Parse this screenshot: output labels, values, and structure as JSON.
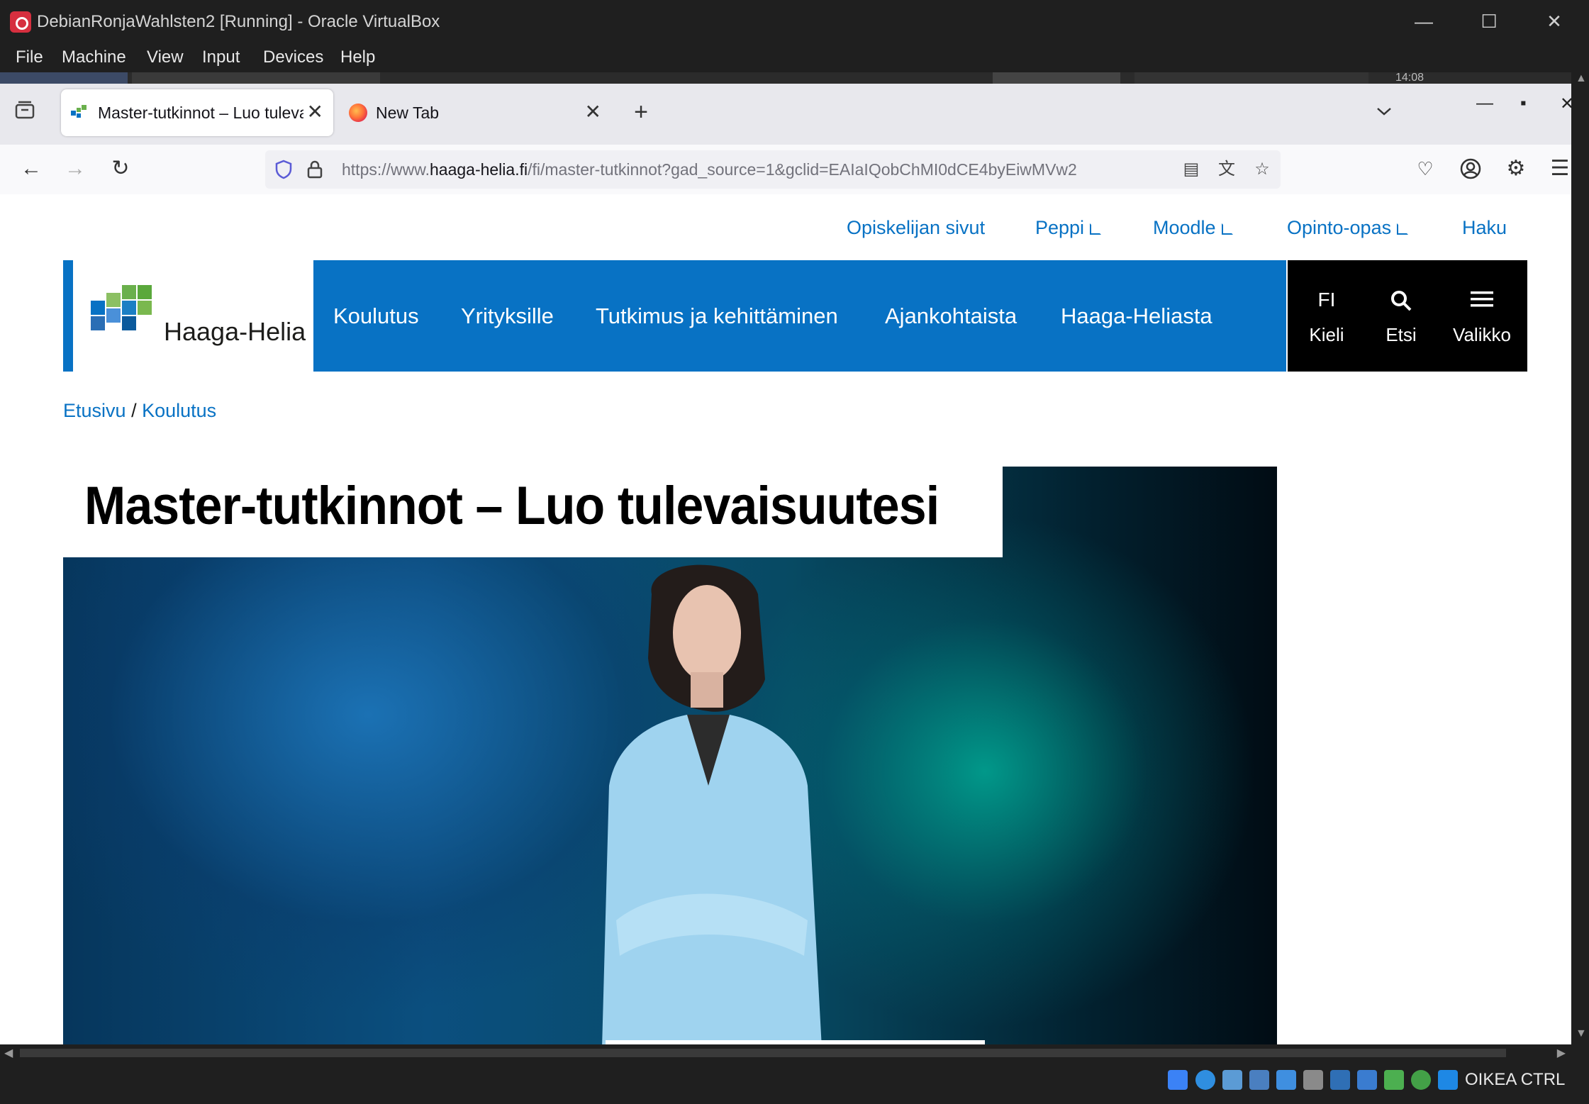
{
  "vbox": {
    "window_title": "DebianRonjaWahlsten2 [Running] - Oracle VirtualBox",
    "menu": [
      "File",
      "Machine",
      "View",
      "Input",
      "Devices",
      "Help"
    ],
    "host_key": "OIKEA CTRL"
  },
  "guest_panel": {
    "clock": "14:08"
  },
  "browser": {
    "tabs": [
      {
        "title": "Master-tutkinnot – Luo tulevaisuutesi",
        "active": true
      },
      {
        "title": "New Tab",
        "active": false
      }
    ],
    "url_prefix": "https://www.",
    "url_host": "haaga-helia.fi",
    "url_path": "/fi/master-tutkinnot?gad_source=1&gclid=EAIaIQobChMI0dCE4byEiwMVw2"
  },
  "site": {
    "top_links": {
      "student_pages": "Opiskelijan sivut",
      "peppi": "Peppi",
      "moodle": "Moodle",
      "guide": "Opinto-opas",
      "search": "Haku"
    },
    "logo_text": "Haaga-Helia",
    "nav": [
      "Koulutus",
      "Yrityksille",
      "Tutkimus ja kehittäminen",
      "Ajankohtaista",
      "Haaga-Heliasta"
    ],
    "utility": {
      "lang_code": "FI",
      "lang_label": "Kieli",
      "search_label": "Etsi",
      "menu_label": "Valikko"
    },
    "breadcrumb": {
      "home": "Etusivu",
      "sep": "/",
      "current": "Koulutus"
    },
    "hero_title": "Master-tutkinnot – Luo tulevaisuutesi"
  },
  "colors": {
    "brand_blue": "#0872c4",
    "util_bg": "#000000"
  }
}
